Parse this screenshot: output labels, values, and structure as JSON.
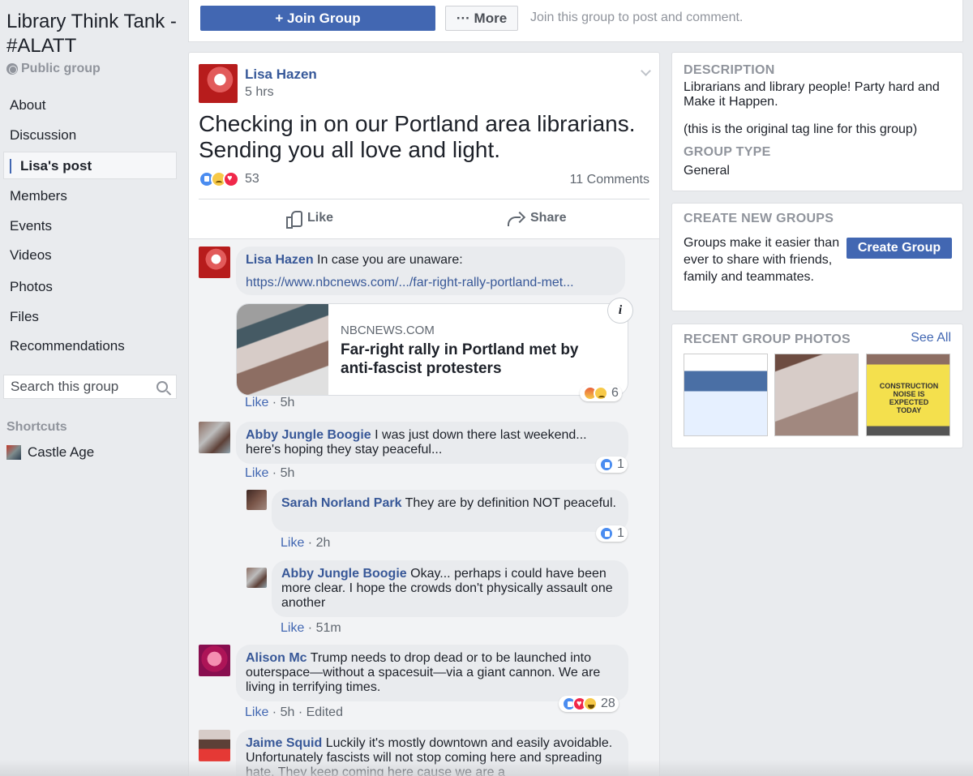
{
  "group": {
    "title": "Library Think Tank - #ALATT",
    "privacy": "Public group"
  },
  "nav": {
    "items": [
      {
        "label": "About"
      },
      {
        "label": "Discussion"
      },
      {
        "label": "Lisa's post",
        "active": true
      },
      {
        "label": "Members"
      },
      {
        "label": "Events"
      },
      {
        "label": "Videos"
      },
      {
        "label": "Photos"
      },
      {
        "label": "Files"
      },
      {
        "label": "Recommendations"
      }
    ],
    "search_placeholder": "Search this group",
    "shortcuts_heading": "Shortcuts",
    "shortcuts": [
      {
        "label": "Castle Age",
        "icon": "castle-age-icon"
      }
    ]
  },
  "topbar": {
    "join_label": "+ Join Group",
    "more_label": "··· More",
    "hint": "Join this group to post and comment."
  },
  "post": {
    "author": "Lisa Hazen",
    "time": "5 hrs",
    "text": "Checking in on our Portland area librarians. Sending you all love and light.",
    "reaction_count": "53",
    "reactions": [
      "like",
      "sad",
      "love"
    ],
    "comments_count": "11 Comments",
    "like_label": "Like",
    "share_label": "Share"
  },
  "comments": [
    {
      "author": "Lisa Hazen",
      "text": "In case you are unaware:",
      "link": "https://www.nbcnews.com/.../far-right-rally-portland-met...",
      "card": {
        "domain": "NBCNEWS.COM",
        "title": "Far-right rally in Portland met by anti-fascist protesters"
      },
      "like": "Like",
      "time": "5h",
      "reaction_count": "6"
    },
    {
      "author": "Abby Jungle Boogie",
      "text": "I was just down there last weekend... here's hoping they stay peaceful...",
      "like": "Like",
      "time": "5h",
      "reaction_count": "1"
    },
    {
      "author": "Sarah Norland Park",
      "text": "They are by definition NOT peaceful.",
      "like": "Like",
      "time": "2h",
      "reaction_count": "1"
    },
    {
      "author": "Abby Jungle Boogie",
      "text": "Okay... perhaps i could have been more clear. I hope the crowds don't physically assault one another",
      "like": "Like",
      "time": "51m"
    },
    {
      "author": "Alison Mc",
      "text": "Trump needs to drop dead or to be launched into outerspace—without a spacesuit—via a giant cannon. We are living in terrifying times.",
      "like": "Like",
      "time": "5h",
      "edited": "Edited",
      "reaction_count": "28"
    },
    {
      "author": "Jaime Squid",
      "text": "Luckily it's mostly downtown and easily avoidable. Unfortunately fascists will not stop coming here and spreading hate. They keep coming here cause we are a"
    }
  ],
  "sidebar": {
    "description_h": "DESCRIPTION",
    "description_1": "Librarians and library people! Party hard and Make it Happen.",
    "description_2": "(this is the original tag line for this group)",
    "type_h": "GROUP TYPE",
    "type_v": "General",
    "create_h": "CREATE NEW GROUPS",
    "create_t": "Groups make it easier than ever to share with friends, family and teammates.",
    "create_btn": "Create Group",
    "photos_h": "RECENT GROUP PHOTOS",
    "see_all": "See All",
    "photo3_text": "CONSTRUCTION NOISE IS EXPECTED TODAY"
  },
  "colors": {
    "accent": "#4267b2",
    "link": "#365899",
    "background": "#e9ebee"
  }
}
